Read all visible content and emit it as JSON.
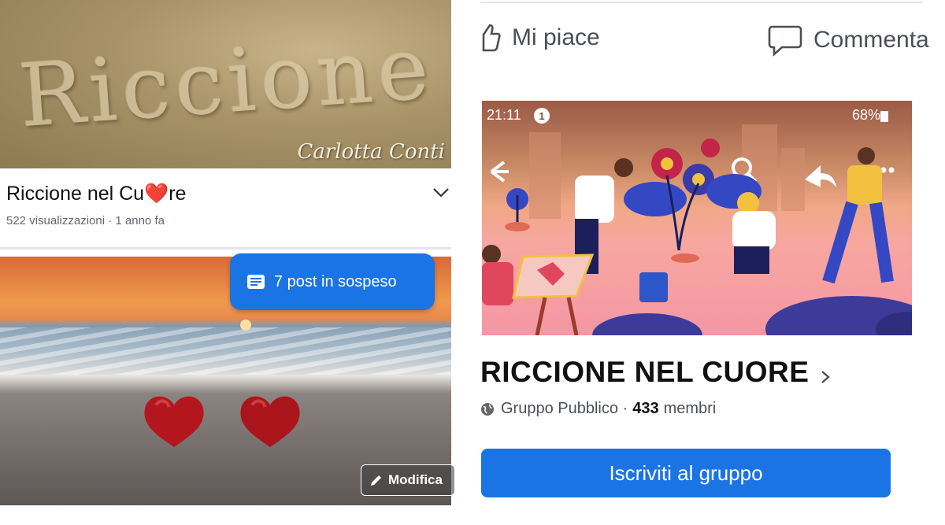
{
  "left_panel": {
    "video": {
      "sand_text": "Riccione",
      "credit": "Carlotta Conti",
      "title": "Riccione nel Cu❤️re",
      "meta": "522 visualizzazioni · 1 anno fa"
    },
    "photo": {
      "pending_label": "7 post in sospeso",
      "edit_label": "Modifica"
    }
  },
  "right_panel": {
    "actions": {
      "like_label": "Mi piace",
      "comment_label": "Commenta"
    },
    "cover": {
      "status_time": "21:11",
      "status_badge": "1",
      "status_battery": "68%"
    },
    "group": {
      "name": "RICCIONE NEL CUORE",
      "privacy": "Gruppo Pubblico ·",
      "member_count": "433",
      "member_label": "membri",
      "join_label": "Iscriviti al gruppo"
    }
  },
  "colors": {
    "facebook_blue": "#1b74e4",
    "heart_red": "#b3171d",
    "text_dark": "#111111",
    "text_muted": "#606770"
  },
  "icons": [
    "chevron-down-icon",
    "post-list-icon",
    "pencil-icon",
    "thumbs-up-icon",
    "comment-icon",
    "globe-icon",
    "chevron-right-icon"
  ]
}
